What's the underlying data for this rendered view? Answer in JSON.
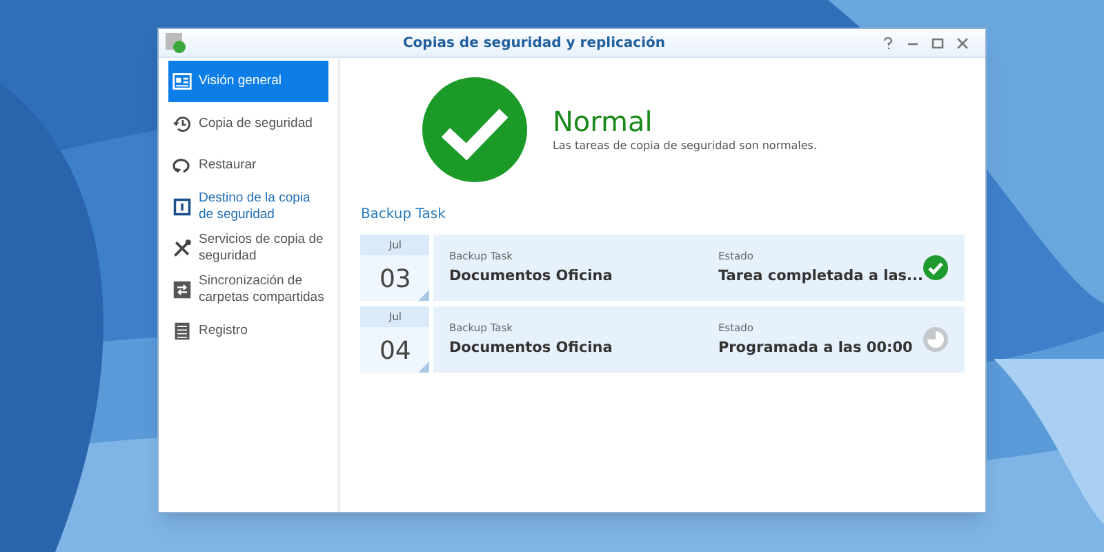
{
  "window": {
    "title": "Copias de seguridad y replicación"
  },
  "sidebar": {
    "items": [
      {
        "label": "Visión general",
        "selected": true,
        "hovered": false
      },
      {
        "label": "Copia de seguridad",
        "selected": false,
        "hovered": false
      },
      {
        "label": "Restaurar",
        "selected": false,
        "hovered": false
      },
      {
        "label": "Destino de la copia de seguridad",
        "selected": false,
        "hovered": true
      },
      {
        "label": "Servicios de copia de seguridad",
        "selected": false,
        "hovered": false
      },
      {
        "label": "Sincronización de carpetas compartidas",
        "selected": false,
        "hovered": false
      },
      {
        "label": "Registro",
        "selected": false,
        "hovered": false
      }
    ]
  },
  "status": {
    "title": "Normal",
    "description": "Las tareas de copia de seguridad son normales."
  },
  "section_title": "Backup Task",
  "tasks": [
    {
      "month": "Jul",
      "day": "03",
      "task_label": "Backup Task",
      "task_name": "Documentos Oficina",
      "status_label": "Estado",
      "status_text": "Tarea completada a las...",
      "kind": "done"
    },
    {
      "month": "Jul",
      "day": "04",
      "task_label": "Backup Task",
      "task_name": "Documentos Oficina",
      "status_label": "Estado",
      "status_text": "Programada a las 00:00",
      "kind": "scheduled"
    }
  ]
}
